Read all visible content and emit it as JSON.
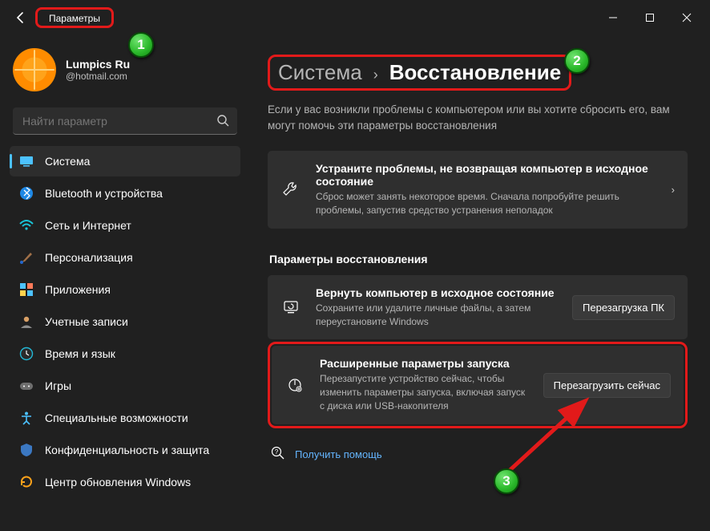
{
  "app": {
    "title": "Параметры"
  },
  "account": {
    "name": "Lumpics Ru",
    "email": "@hotmail.com"
  },
  "search": {
    "placeholder": "Найти параметр"
  },
  "sidebar": {
    "items": [
      {
        "label": "Система"
      },
      {
        "label": "Bluetooth и устройства"
      },
      {
        "label": "Сеть и Интернет"
      },
      {
        "label": "Персонализация"
      },
      {
        "label": "Приложения"
      },
      {
        "label": "Учетные записи"
      },
      {
        "label": "Время и язык"
      },
      {
        "label": "Игры"
      },
      {
        "label": "Специальные возможности"
      },
      {
        "label": "Конфиденциальность и защита"
      },
      {
        "label": "Центр обновления Windows"
      }
    ]
  },
  "breadcrumb": {
    "root": "Система",
    "page": "Восстановление"
  },
  "intro": "Если у вас возникли проблемы с компьютером или вы хотите сбросить его, вам могут помочь эти параметры восстановления",
  "troubleshoot": {
    "title": "Устраните проблемы, не возвращая компьютер в исходное состояние",
    "desc": "Сброс может занять некоторое время. Сначала попробуйте решить проблемы, запустив средство устранения неполадок"
  },
  "sectionHeader": "Параметры восстановления",
  "reset": {
    "title": "Вернуть компьютер в исходное состояние",
    "desc": "Сохраните или удалите личные файлы, а затем переустановите Windows",
    "button": "Перезагрузка ПК"
  },
  "advanced": {
    "title": "Расширенные параметры запуска",
    "desc": "Перезапустите устройство сейчас, чтобы изменить параметры запуска, включая запуск с диска или USB-накопителя",
    "button": "Перезагрузить сейчас"
  },
  "help": {
    "label": "Получить помощь"
  },
  "markers": {
    "m1": "1",
    "m2": "2",
    "m3": "3"
  }
}
